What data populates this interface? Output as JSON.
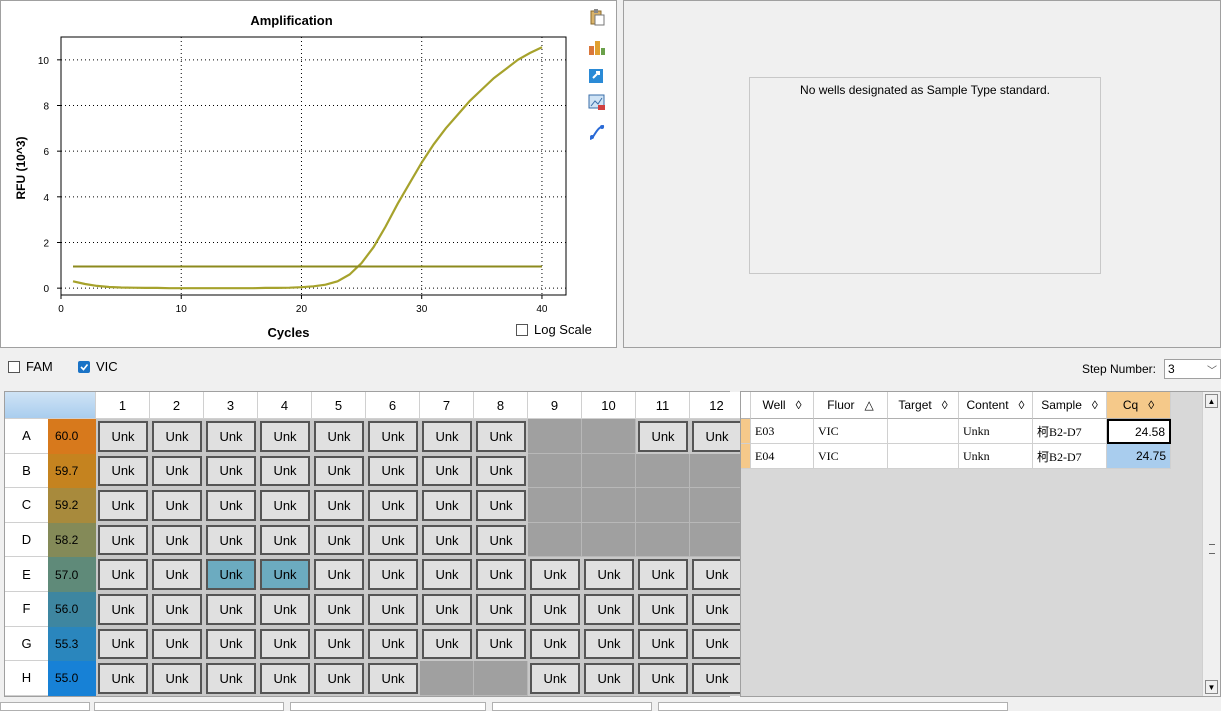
{
  "chart_data": {
    "type": "line",
    "title": "Amplification",
    "xlabel": "Cycles",
    "ylabel": "RFU (10^3)",
    "xlim": [
      0,
      42
    ],
    "ylim": [
      -0.3,
      11
    ],
    "xticks": [
      0,
      10,
      20,
      30,
      40
    ],
    "yticks": [
      0,
      2,
      4,
      6,
      8,
      10
    ],
    "grid": "dotted",
    "series": [
      {
        "color": "#a6a22c",
        "x": [
          1,
          2,
          3,
          4,
          5,
          6,
          7,
          8,
          9,
          10,
          11,
          12,
          13,
          14,
          15,
          16,
          17,
          18,
          19,
          20,
          21,
          22,
          23,
          24,
          25,
          26,
          27,
          28,
          29,
          30,
          31,
          32,
          33,
          34,
          35,
          36,
          37,
          38,
          39,
          40
        ],
        "values": [
          0.3,
          0.18,
          0.1,
          0.05,
          0.03,
          0.02,
          0.01,
          0.01,
          0.0,
          0.0,
          0.0,
          0.0,
          0.0,
          0.0,
          0.0,
          0.0,
          0.01,
          0.01,
          0.02,
          0.04,
          0.08,
          0.15,
          0.3,
          0.6,
          1.1,
          1.8,
          2.7,
          3.7,
          4.6,
          5.5,
          6.3,
          7.0,
          7.6,
          8.2,
          8.7,
          9.2,
          9.6,
          10.0,
          10.3,
          10.55
        ]
      },
      {
        "color": "#8c8a1e",
        "x": [
          1,
          40
        ],
        "values": [
          0.95,
          0.95
        ]
      }
    ]
  },
  "chart_panel": {
    "log_scale_label": "Log Scale",
    "log_scale_checked": false,
    "tool_icons": [
      "clipboard-icon",
      "bar-chart-icon",
      "export-icon",
      "image-icon",
      "curve-icon"
    ]
  },
  "standard_panel": {
    "message": "No wells designated as Sample Type standard."
  },
  "fluorophores": [
    {
      "label": "FAM",
      "checked": false
    },
    {
      "label": "VIC",
      "checked": true
    }
  ],
  "step": {
    "label": "Step Number:",
    "value": "3"
  },
  "plate": {
    "columns": [
      "1",
      "2",
      "3",
      "4",
      "5",
      "6",
      "7",
      "8",
      "9",
      "10",
      "11",
      "12"
    ],
    "rows": [
      {
        "label": "A",
        "temp": "60.0",
        "color": "#d7791c",
        "wells": [
          "Unk",
          "Unk",
          "Unk",
          "Unk",
          "Unk",
          "Unk",
          "Unk",
          "Unk",
          "",
          "",
          "Unk",
          "Unk"
        ]
      },
      {
        "label": "B",
        "temp": "59.7",
        "color": "#c5831f",
        "wells": [
          "Unk",
          "Unk",
          "Unk",
          "Unk",
          "Unk",
          "Unk",
          "Unk",
          "Unk",
          "",
          "",
          "",
          ""
        ]
      },
      {
        "label": "C",
        "temp": "59.2",
        "color": "#a88a3c",
        "wells": [
          "Unk",
          "Unk",
          "Unk",
          "Unk",
          "Unk",
          "Unk",
          "Unk",
          "Unk",
          "",
          "",
          "",
          ""
        ]
      },
      {
        "label": "D",
        "temp": "58.2",
        "color": "#848a58",
        "wells": [
          "Unk",
          "Unk",
          "Unk",
          "Unk",
          "Unk",
          "Unk",
          "Unk",
          "Unk",
          "",
          "",
          "",
          ""
        ]
      },
      {
        "label": "E",
        "temp": "57.0",
        "color": "#5f8a79",
        "wells": [
          "Unk",
          "Unk",
          "Unk",
          "Unk",
          "Unk",
          "Unk",
          "Unk",
          "Unk",
          "Unk",
          "Unk",
          "Unk",
          "Unk"
        ]
      },
      {
        "label": "F",
        "temp": "56.0",
        "color": "#3e86a0",
        "wells": [
          "Unk",
          "Unk",
          "Unk",
          "Unk",
          "Unk",
          "Unk",
          "Unk",
          "Unk",
          "Unk",
          "Unk",
          "Unk",
          "Unk"
        ]
      },
      {
        "label": "G",
        "temp": "55.3",
        "color": "#2a86bd",
        "wells": [
          "Unk",
          "Unk",
          "Unk",
          "Unk",
          "Unk",
          "Unk",
          "Unk",
          "Unk",
          "Unk",
          "Unk",
          "Unk",
          "Unk"
        ]
      },
      {
        "label": "H",
        "temp": "55.0",
        "color": "#1781d6",
        "wells": [
          "Unk",
          "Unk",
          "Unk",
          "Unk",
          "Unk",
          "Unk",
          "",
          "",
          "Unk",
          "Unk",
          "Unk",
          "Unk"
        ]
      }
    ],
    "selected": [
      "E3",
      "E4"
    ]
  },
  "table": {
    "headers": [
      {
        "label": "Well",
        "sort": "◊"
      },
      {
        "label": "Fluor",
        "sort": "△"
      },
      {
        "label": "Target",
        "sort": "◊"
      },
      {
        "label": "Content",
        "sort": "◊"
      },
      {
        "label": "Sample",
        "sort": "◊"
      },
      {
        "label": "Cq",
        "sort": "◊"
      }
    ],
    "rows": [
      [
        "E03",
        "VIC",
        "",
        "Unkn",
        "柯B2-D7",
        "24.58"
      ],
      [
        "E04",
        "VIC",
        "",
        "Unkn",
        "柯B2-D7",
        "24.75"
      ]
    ]
  }
}
